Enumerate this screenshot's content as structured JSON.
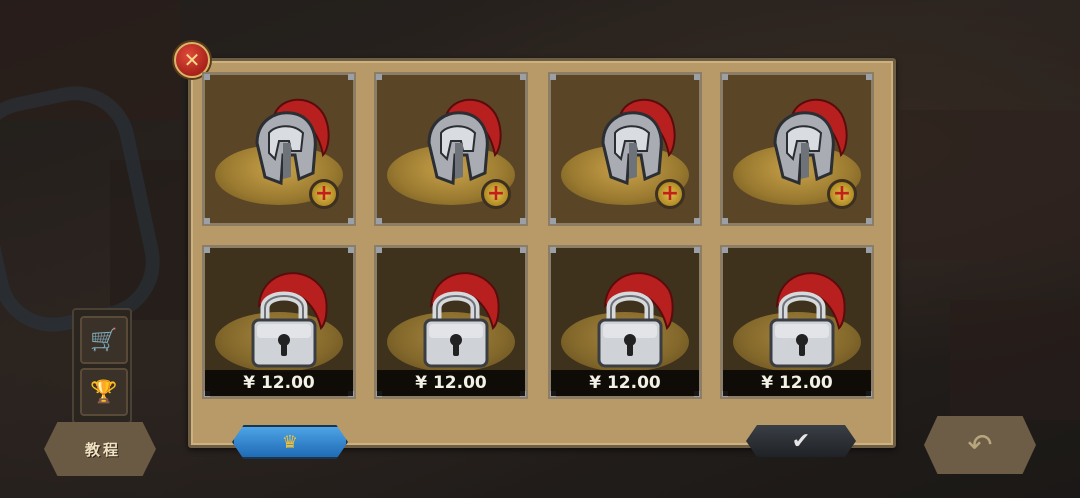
{
  "window": {
    "title": ""
  },
  "colors": {
    "panel": "#b79a67",
    "slot_unlocked": "#5a4626",
    "slot_locked": "#3e321c",
    "helmet_crest": "#b82020",
    "price_text": "#f3f0e6"
  },
  "side_menu": {
    "items": [
      {
        "icon": "cart-icon"
      },
      {
        "icon": "trophy-icon"
      }
    ]
  },
  "tutorial": {
    "label": "教程"
  },
  "back": {
    "icon": "back-arrow-icon"
  },
  "close": {
    "glyph": "✕"
  },
  "slots": [
    {
      "state": "unlocked",
      "icon": "spartan-helmet-icon",
      "badge": "+"
    },
    {
      "state": "unlocked",
      "icon": "spartan-helmet-icon",
      "badge": "+"
    },
    {
      "state": "unlocked",
      "icon": "spartan-helmet-icon",
      "badge": "+"
    },
    {
      "state": "unlocked",
      "icon": "spartan-helmet-icon",
      "badge": "+"
    },
    {
      "state": "locked",
      "icon": "padlock-icon",
      "price": "¥ 12.00"
    },
    {
      "state": "locked",
      "icon": "padlock-icon",
      "price": "¥ 12.00"
    },
    {
      "state": "locked",
      "icon": "padlock-icon",
      "price": "¥ 12.00"
    },
    {
      "state": "locked",
      "icon": "padlock-icon",
      "price": "¥ 12.00"
    }
  ],
  "footer": {
    "left_tab_icon": "crown-icon",
    "confirm_icon": "checkmark-icon"
  }
}
